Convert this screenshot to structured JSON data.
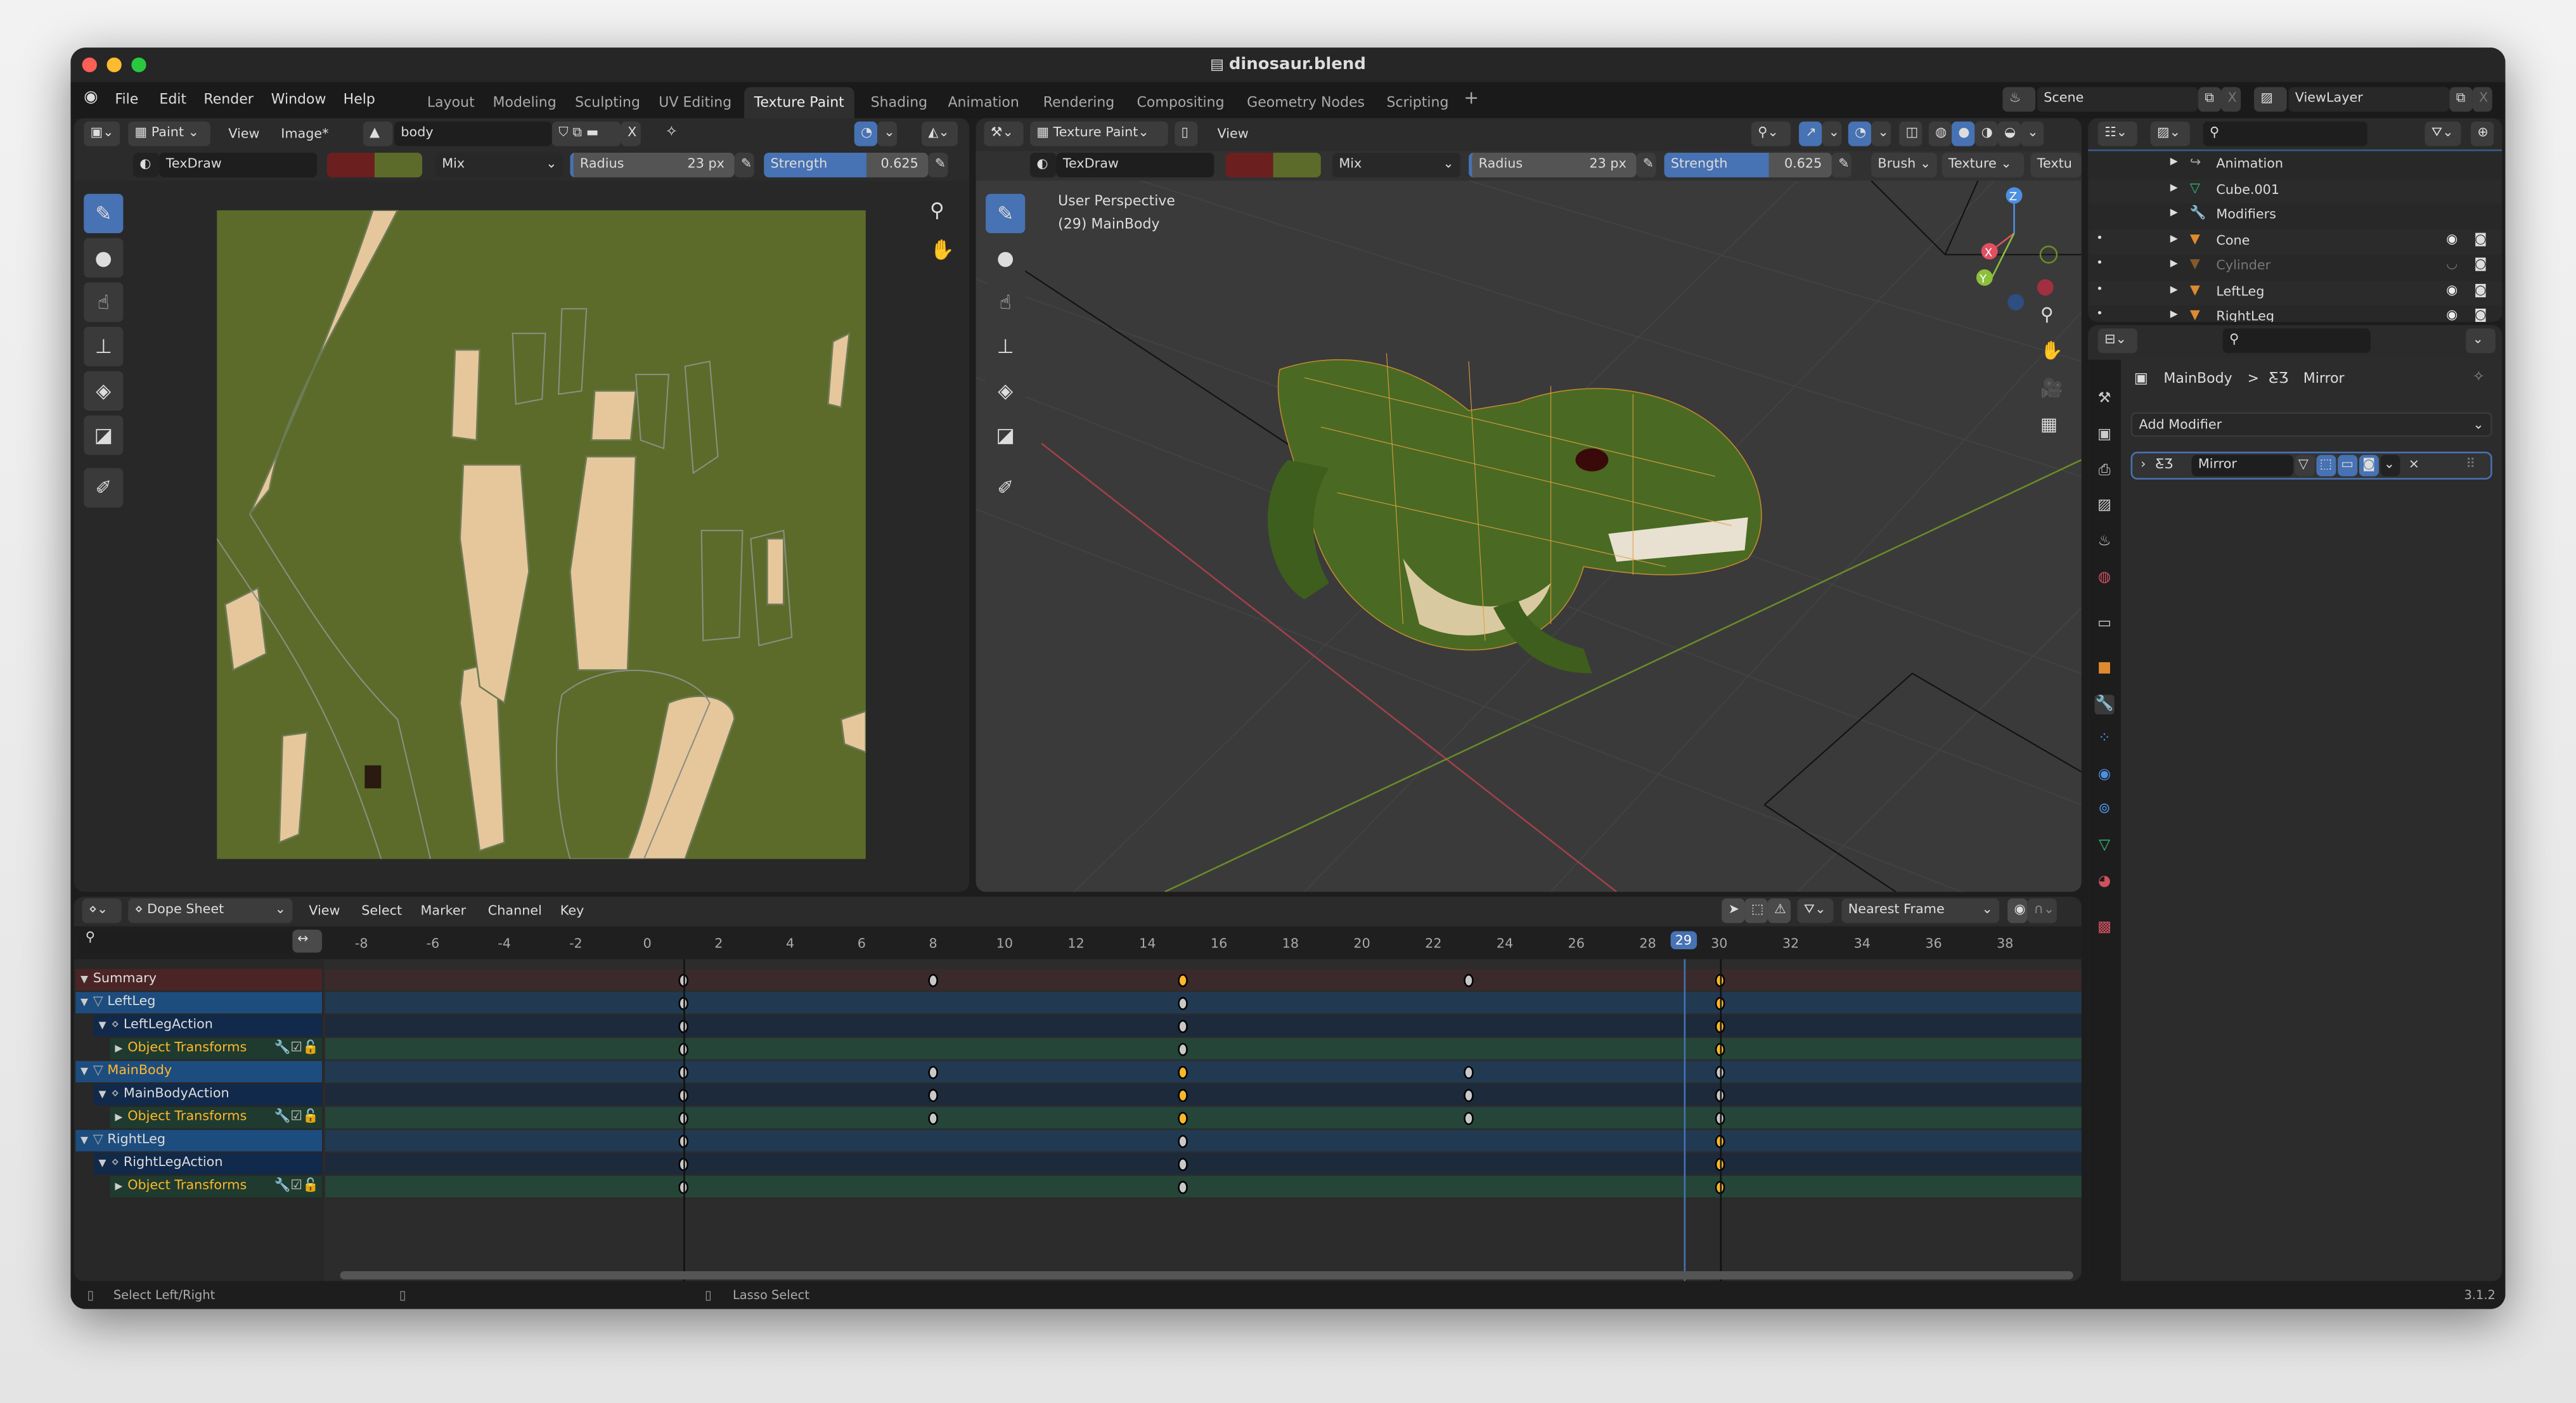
{
  "window": {
    "title": "dinosaur.blend",
    "file_icon": "document-icon"
  },
  "menu": [
    "File",
    "Edit",
    "Render",
    "Window",
    "Help"
  ],
  "workspaces": [
    {
      "label": "Layout"
    },
    {
      "label": "Modeling"
    },
    {
      "label": "Sculpting"
    },
    {
      "label": "UV Editing"
    },
    {
      "label": "Texture Paint",
      "active": true
    },
    {
      "label": "Shading"
    },
    {
      "label": "Animation"
    },
    {
      "label": "Rendering"
    },
    {
      "label": "Compositing"
    },
    {
      "label": "Geometry Nodes"
    },
    {
      "label": "Scripting"
    }
  ],
  "add_workspace": "+",
  "scene": {
    "value": "Scene",
    "close": "X"
  },
  "viewlayer": {
    "value": "ViewLayer",
    "close": "X"
  },
  "image_editor": {
    "mode": "Paint",
    "menus": [
      "View",
      "Image*"
    ],
    "image_name": "body",
    "close": "X",
    "brush": "TexDraw",
    "blend": "Mix",
    "radius_label": "Radius",
    "radius": "23 px",
    "strength_label": "Strength",
    "strength": "0.625",
    "colors": {
      "primary": "#6b1f1f",
      "secondary": "#5d6b2a",
      "uv_bg": "#5c6b2a",
      "island": "#e6c79c"
    }
  },
  "viewport": {
    "mode": "Texture Paint",
    "menus": [
      "View"
    ],
    "brush": "TexDraw",
    "blend": "Mix",
    "radius_label": "Radius",
    "radius": "23 px",
    "strength_label": "Strength",
    "strength": "0.625",
    "extra": [
      "Brush",
      "Texture",
      "Textu"
    ],
    "overlay": {
      "perspective": "User Perspective",
      "object": "(29) MainBody"
    },
    "gizmo": {
      "x": "X",
      "y": "Y",
      "z": "Z"
    }
  },
  "outliner": {
    "items": [
      {
        "label": "Animation",
        "icon": "action-icon"
      },
      {
        "label": "Cube.001",
        "icon": "mesh-icon"
      },
      {
        "label": "Modifiers",
        "icon": "wrench-icon"
      },
      {
        "label": "Cone",
        "icon": "cone-object-icon",
        "visible": true
      },
      {
        "label": "Cylinder",
        "icon": "cone-object-icon",
        "visible": false
      },
      {
        "label": "LeftLeg",
        "icon": "cone-object-icon",
        "visible": true
      },
      {
        "label": "RightLeg",
        "icon": "cone-object-icon",
        "visible": true
      }
    ]
  },
  "properties": {
    "breadcrumb": {
      "object": "MainBody",
      "separator": ">",
      "modifier": "Mirror"
    },
    "add_modifier": "Add Modifier",
    "modifier": {
      "name": "Mirror",
      "close": "×"
    }
  },
  "dopesheet": {
    "mode": "Dope Sheet",
    "menus": [
      "View",
      "Select",
      "Marker",
      "Channel",
      "Key"
    ],
    "snapping": "Nearest Frame",
    "ticks": [
      -8,
      -6,
      -4,
      -2,
      0,
      2,
      4,
      6,
      8,
      10,
      12,
      14,
      16,
      18,
      20,
      22,
      24,
      26,
      28,
      30,
      32,
      34,
      36,
      38
    ],
    "current_frame": 29,
    "rows": [
      {
        "label": "Summary",
        "type": "summary",
        "keys": [
          {
            "f": 1
          },
          {
            "f": 8
          },
          {
            "f": 15,
            "sel": true
          },
          {
            "f": 23
          },
          {
            "f": 30,
            "sel": true
          }
        ]
      },
      {
        "label": "LeftLeg",
        "type": "object",
        "keys": [
          {
            "f": 1
          },
          {
            "f": 15
          },
          {
            "f": 30,
            "sel": true
          }
        ]
      },
      {
        "label": "LeftLegAction",
        "type": "action",
        "keys": [
          {
            "f": 1
          },
          {
            "f": 15
          },
          {
            "f": 30,
            "sel": true
          }
        ]
      },
      {
        "label": "Object Transforms",
        "type": "group",
        "keys": [
          {
            "f": 1
          },
          {
            "f": 15
          },
          {
            "f": 30,
            "sel": true
          }
        ]
      },
      {
        "label": "MainBody",
        "type": "object",
        "active": true,
        "keys": [
          {
            "f": 1
          },
          {
            "f": 8
          },
          {
            "f": 15,
            "sel": true
          },
          {
            "f": 23
          },
          {
            "f": 30
          }
        ]
      },
      {
        "label": "MainBodyAction",
        "type": "action",
        "keys": [
          {
            "f": 1
          },
          {
            "f": 8
          },
          {
            "f": 15,
            "sel": true
          },
          {
            "f": 23
          },
          {
            "f": 30
          }
        ]
      },
      {
        "label": "Object Transforms",
        "type": "group",
        "keys": [
          {
            "f": 1
          },
          {
            "f": 8
          },
          {
            "f": 15,
            "sel": true
          },
          {
            "f": 23
          },
          {
            "f": 30
          }
        ]
      },
      {
        "label": "RightLeg",
        "type": "object",
        "keys": [
          {
            "f": 1
          },
          {
            "f": 15
          },
          {
            "f": 30,
            "sel": true
          }
        ]
      },
      {
        "label": "RightLegAction",
        "type": "action",
        "keys": [
          {
            "f": 1
          },
          {
            "f": 15
          },
          {
            "f": 30,
            "sel": true
          }
        ]
      },
      {
        "label": "Object Transforms",
        "type": "group",
        "keys": [
          {
            "f": 1
          },
          {
            "f": 15
          },
          {
            "f": 30,
            "sel": true
          }
        ]
      }
    ],
    "colors": {
      "selected": "#ffb829",
      "unselected": "#c8c8c8",
      "playhead": "#4772b3"
    }
  },
  "status": {
    "left": "Select Left/Right",
    "middle": "Lasso Select",
    "version": "3.1.2"
  }
}
